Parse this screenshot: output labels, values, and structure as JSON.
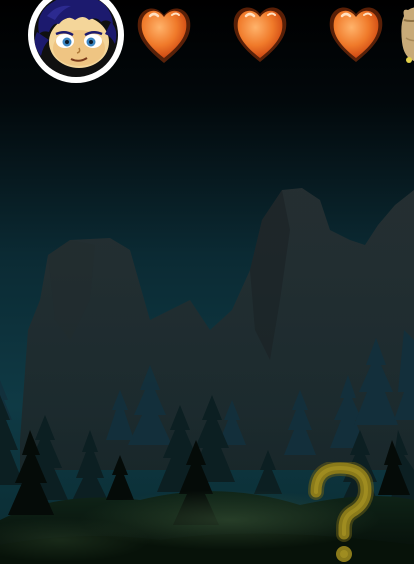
{
  "game": {
    "screen": "forest-night-level",
    "player": {
      "avatar_icon": "boy-face-avatar-icon",
      "lives": 3,
      "life_icon": "heart-icon"
    },
    "inventory": {
      "partially_visible_item_icon": "sack-item-icon"
    },
    "help_button": {
      "icon": "question-mark-icon",
      "label": "?"
    },
    "colors": {
      "sky_top": "#000000",
      "sky_bottom": "#0d3440",
      "heart": "#f07a2a",
      "heart_glow": "#ff5a10",
      "help_icon": "#8a7a1a",
      "avatar_ring": "#ffffff",
      "hair": "#1c1a6e"
    }
  }
}
